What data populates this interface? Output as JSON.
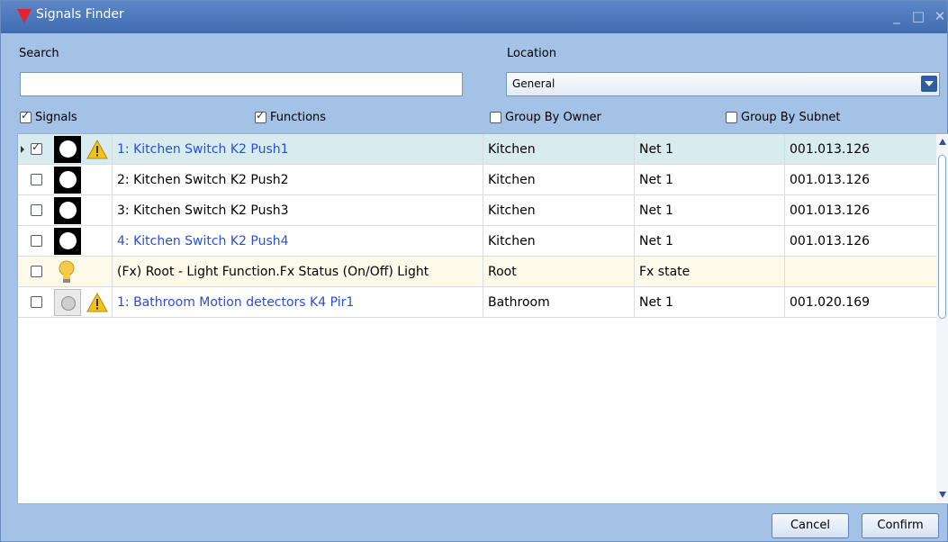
{
  "window": {
    "title": "Signals Finder",
    "accent_color": "#e8222a"
  },
  "search": {
    "label": "Search",
    "value": ""
  },
  "location": {
    "label": "Location",
    "selected": "General"
  },
  "filters": {
    "signals": {
      "label": "Signals",
      "checked": true
    },
    "functions": {
      "label": "Functions",
      "checked": true
    },
    "group_by_owner": {
      "label": "Group By Owner",
      "checked": false
    },
    "group_by_subnet": {
      "label": "Group By Subnet",
      "checked": false
    }
  },
  "rows": [
    {
      "checked": true,
      "icon": "switch-icon",
      "warning": true,
      "name": "1: Kitchen Switch K2 Push1",
      "location": "Kitchen",
      "net": "Net 1",
      "address": "001.013.126"
    },
    {
      "checked": false,
      "icon": "switch-icon",
      "warning": false,
      "name": "2: Kitchen Switch K2 Push2",
      "location": "Kitchen",
      "net": "Net 1",
      "address": "001.013.126"
    },
    {
      "checked": false,
      "icon": "switch-icon",
      "warning": false,
      "name": "3: Kitchen Switch K2 Push3",
      "location": "Kitchen",
      "net": "Net 1",
      "address": "001.013.126"
    },
    {
      "checked": false,
      "icon": "switch-icon",
      "warning": false,
      "name": "4: Kitchen Switch K2 Push4",
      "location": "Kitchen",
      "net": "Net 1",
      "address": "001.013.126"
    },
    {
      "checked": false,
      "icon": "light-bulb-icon",
      "warning": false,
      "name": "(Fx) Root - Light Function.Fx Status (On/Off) Light",
      "location": "Root",
      "net": "Fx state",
      "address": ""
    },
    {
      "checked": false,
      "icon": "motion-detector-icon",
      "warning": true,
      "name": "1: Bathroom Motion detectors K4 Pir1",
      "location": "Bathroom",
      "net": "Net 1",
      "address": "001.020.169"
    }
  ],
  "buttons": {
    "cancel": "Cancel",
    "confirm": "Confirm"
  }
}
